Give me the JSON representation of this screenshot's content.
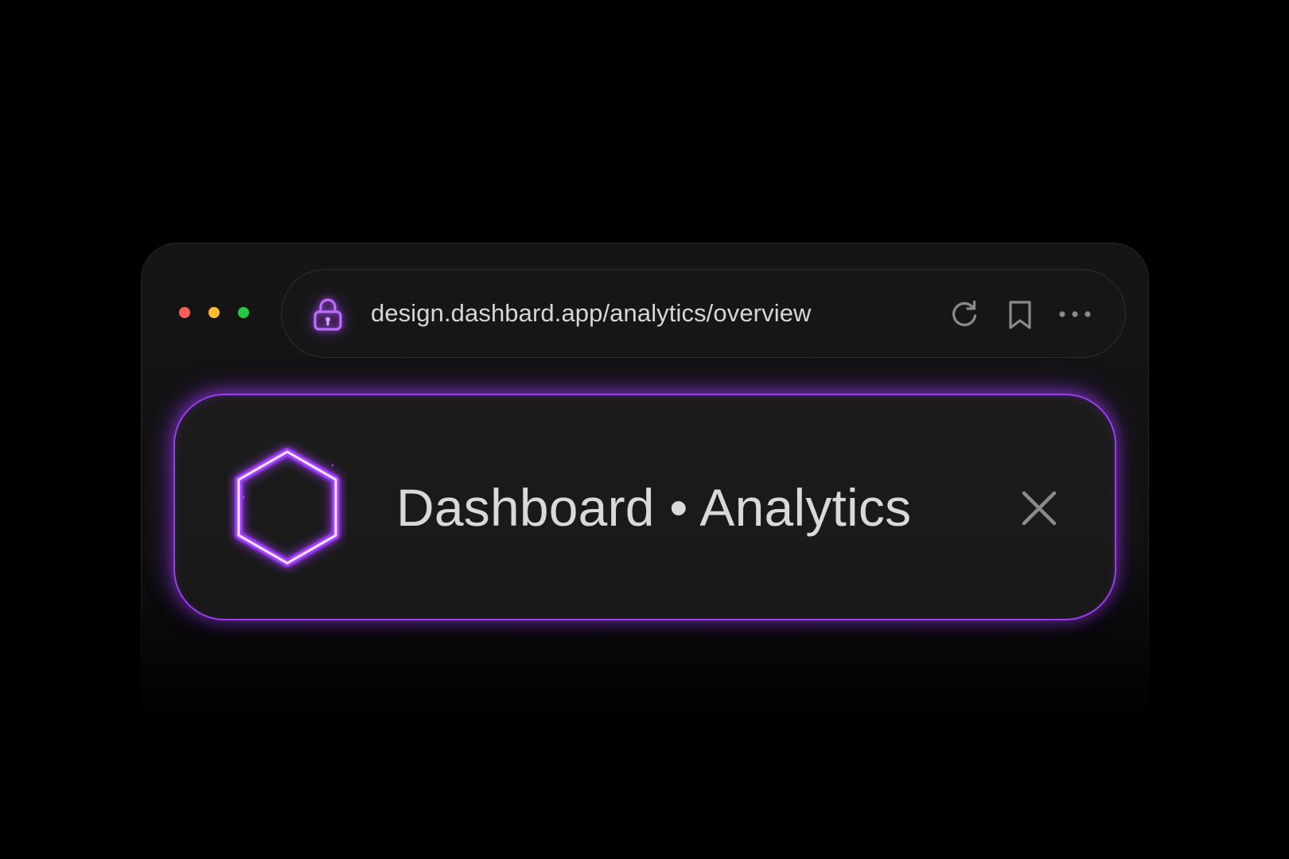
{
  "colors": {
    "background": "#000000",
    "window_bg": "#141414",
    "accent": "#a24bff",
    "traffic_red": "#ff5f57",
    "traffic_yellow": "#febc2e",
    "traffic_green": "#28c840",
    "text_primary": "#d9d9d9",
    "icon_muted": "#8a8a8a"
  },
  "window": {
    "traffic_lights": [
      "close",
      "minimize",
      "maximize"
    ]
  },
  "address_bar": {
    "url": "design.dashbard.app/analytics/overview",
    "icons": {
      "security": "lock-icon",
      "reload": "reload-icon",
      "bookmark": "bookmark-icon",
      "menu": "more-icon"
    }
  },
  "tab": {
    "title": "Dashboard • Analytics",
    "icons": {
      "logo": "hexagon-icon",
      "close": "close-icon"
    }
  }
}
